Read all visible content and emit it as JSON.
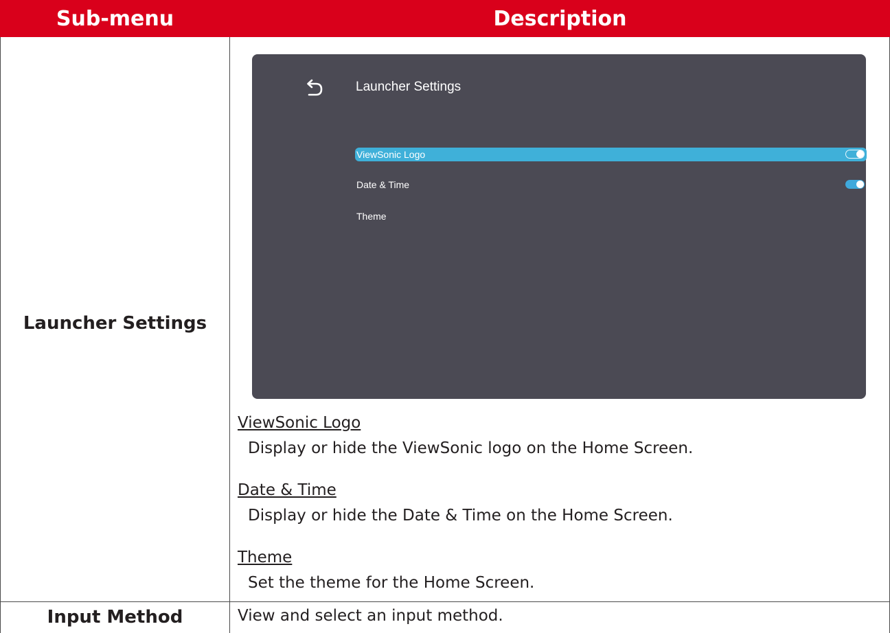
{
  "table": {
    "headers": {
      "submenu": "Sub-menu",
      "description": "Description"
    },
    "rows": [
      {
        "submenu": "Launcher Settings",
        "screen": {
          "title": "Launcher Settings",
          "items": [
            {
              "label": "ViewSonic Logo",
              "toggle": true,
              "selected": true
            },
            {
              "label": "Date & Time",
              "toggle": true,
              "selected": false
            },
            {
              "label": "Theme",
              "toggle": null,
              "selected": false
            }
          ],
          "colors": {
            "background": "#4b4a54",
            "highlight": "#3fb0d9",
            "toggle_on": "#3fa9dc"
          }
        },
        "entries": [
          {
            "term": "ViewSonic Logo",
            "text": "Display or hide the ViewSonic logo on the Home Screen."
          },
          {
            "term": "Date & Time",
            "text": "Display or hide the Date & Time on the Home Screen."
          },
          {
            "term": "Theme",
            "text": "Set the theme for the Home Screen."
          }
        ]
      },
      {
        "submenu": "Input Method",
        "description": "View and select an input method."
      }
    ]
  },
  "colors": {
    "header_bg": "#d9001b",
    "header_text": "#ffffff",
    "body_text": "#231f20"
  }
}
